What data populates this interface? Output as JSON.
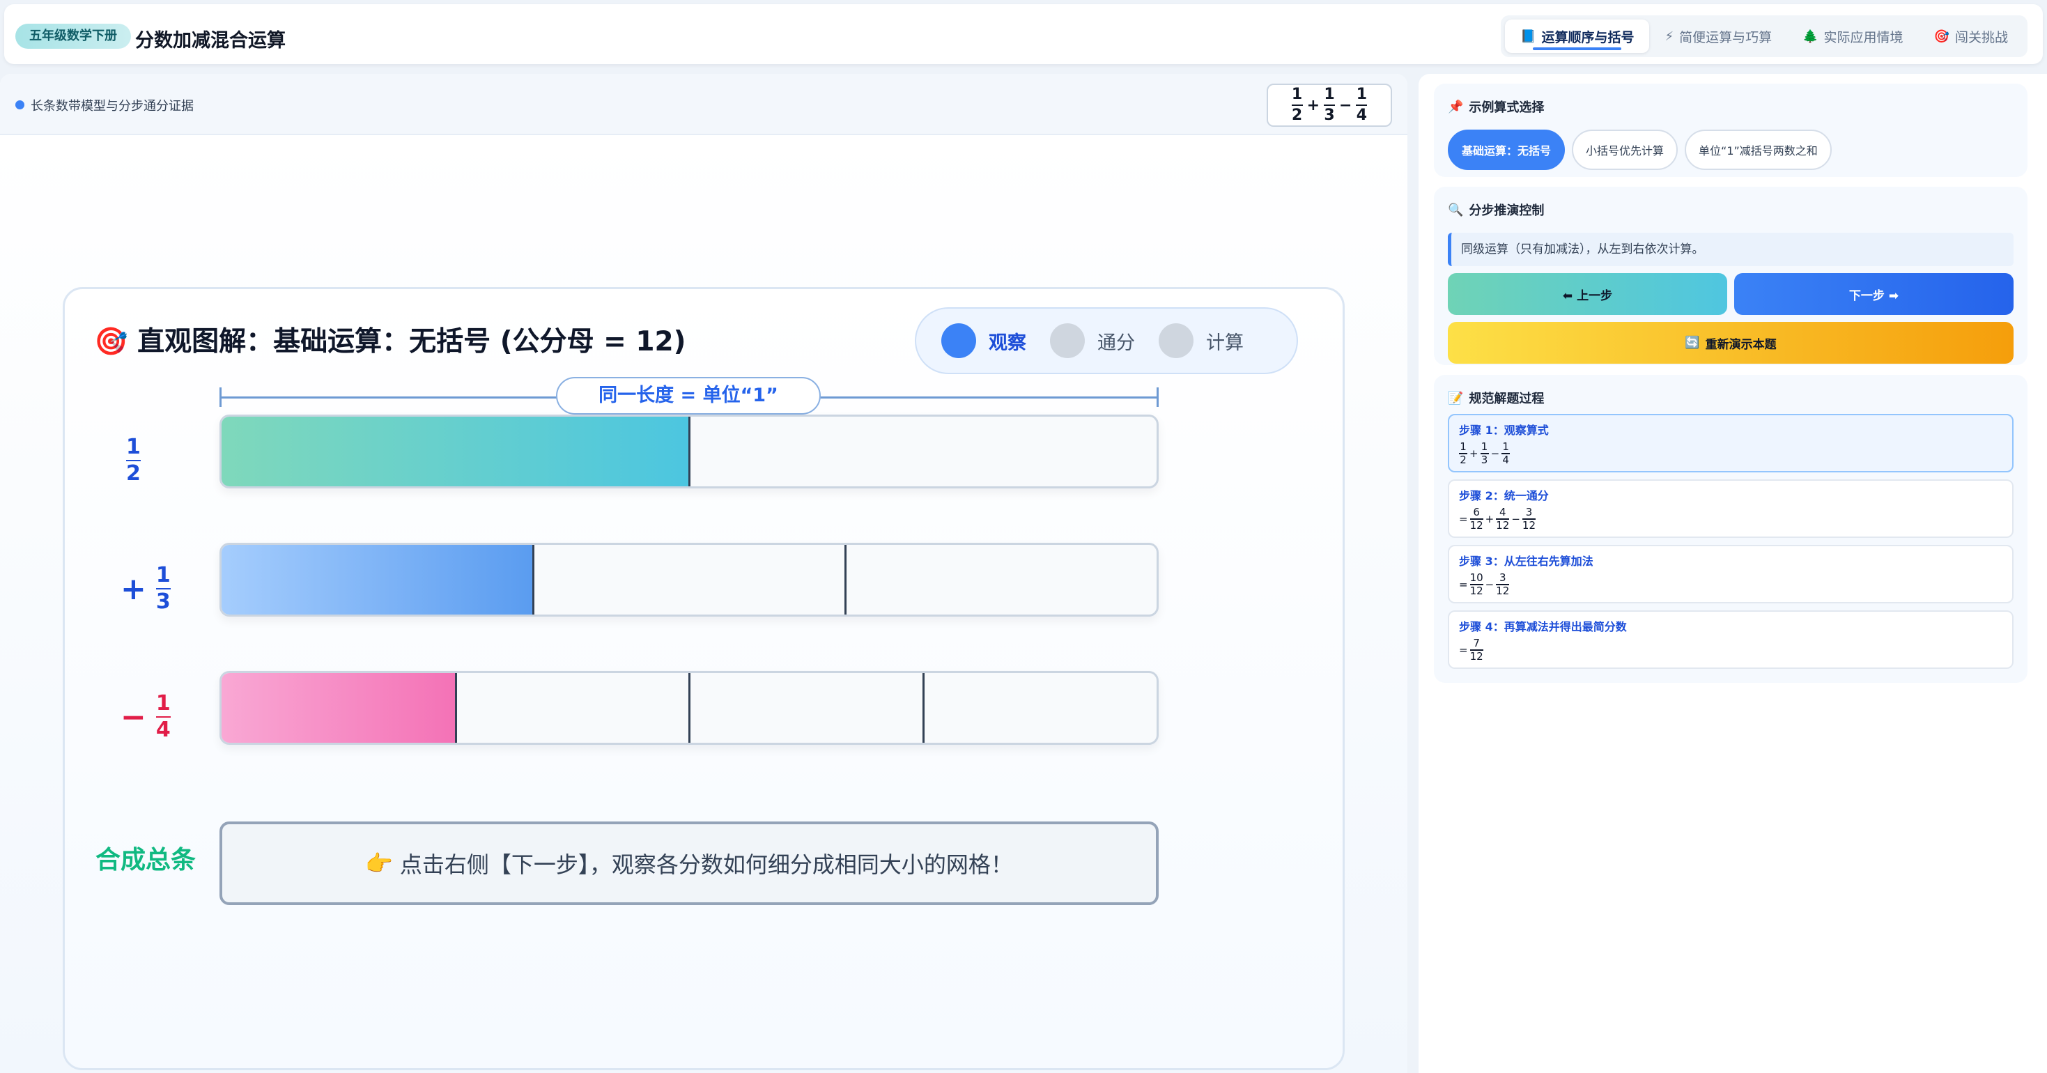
{
  "header": {
    "grade_badge": "五年级数学下册",
    "title": "分数加减混合运算",
    "tabs": [
      {
        "icon": "📘",
        "icon_name": "book-icon",
        "label": "运算顺序与括号",
        "active": true
      },
      {
        "icon": "⚡",
        "icon_name": "lightning-icon",
        "label": "简便运算与巧算",
        "active": false
      },
      {
        "icon": "🌲",
        "icon_name": "tree-icon",
        "label": "实际应用情境",
        "active": false
      },
      {
        "icon": "🎯",
        "icon_name": "target-icon",
        "label": "闯关挑战",
        "active": false
      }
    ]
  },
  "main": {
    "subtitle": "长条数带模型与分步通分证据",
    "expression": {
      "f1": {
        "num": "1",
        "den": "2"
      },
      "op1": "+",
      "f2": {
        "num": "1",
        "den": "3"
      },
      "op2": "−",
      "f3": {
        "num": "1",
        "den": "4"
      }
    },
    "card": {
      "title_icon": "🎯",
      "title": "直观图解：基础运算：无括号 (公分母 = 12)",
      "steps": [
        {
          "label": "观察",
          "active": true
        },
        {
          "label": "通分",
          "active": false
        },
        {
          "label": "计算",
          "active": false
        }
      ],
      "unit_label": "同一长度 = 单位“1”",
      "rows": [
        {
          "sign": "",
          "num": "1",
          "den": "2",
          "fraction_filled": 0.5,
          "parts": 2,
          "color": "#1d4ed8",
          "fill": "linear-gradient(90deg, #7fd8bb, #4cc6e0)"
        },
        {
          "sign": "+",
          "num": "1",
          "den": "3",
          "fraction_filled": 0.3333,
          "parts": 3,
          "color": "#1d4ed8",
          "fill": "linear-gradient(90deg, #a5cdfd, #5a9cf0)"
        },
        {
          "sign": "−",
          "num": "1",
          "den": "4",
          "fraction_filled": 0.25,
          "parts": 4,
          "color": "#e11d48",
          "fill": "linear-gradient(90deg, #f9a8d4, #f472b6)"
        }
      ],
      "total_label": "合成总条",
      "total_icon": "👉",
      "total_hint": "点击右侧【下一步】，观察各分数如何细分成相同大小的网格！"
    }
  },
  "sidebar": {
    "examples": {
      "icon": "📌",
      "title": "示例算式选择",
      "chips": [
        {
          "label": "基础运算：无括号",
          "active": true
        },
        {
          "label": "小括号优先计算",
          "active": false
        },
        {
          "label": "单位“1”减括号两数之和",
          "active": false
        }
      ]
    },
    "control": {
      "icon": "🔍",
      "title": "分步推演控制",
      "hint": "同级运算（只有加减法），从左到右依次计算。",
      "prev_label": "⬅ 上一步",
      "next_label": "下一步 ➡",
      "replay_icon": "🔄",
      "replay_label": "重新演示本题"
    },
    "solution": {
      "icon": "📝",
      "title": "规范解题过程",
      "steps": [
        {
          "title": "步骤 1：观察算式",
          "active": true,
          "expr": [
            {
              "n": "1",
              "d": "2"
            },
            "+",
            {
              "n": "1",
              "d": "3"
            },
            "−",
            {
              "n": "1",
              "d": "4"
            }
          ]
        },
        {
          "title": "步骤 2：统一通分",
          "active": false,
          "expr": [
            "=",
            {
              "n": "6",
              "d": "12"
            },
            "+",
            {
              "n": "4",
              "d": "12"
            },
            "−",
            {
              "n": "3",
              "d": "12"
            }
          ]
        },
        {
          "title": "步骤 3：从左往右先算加法",
          "active": false,
          "expr": [
            "=",
            {
              "n": "10",
              "d": "12"
            },
            "−",
            {
              "n": "3",
              "d": "12"
            }
          ]
        },
        {
          "title": "步骤 4：再算减法并得出最简分数",
          "active": false,
          "expr": [
            "=",
            {
              "n": "7",
              "d": "12"
            }
          ]
        }
      ]
    }
  }
}
